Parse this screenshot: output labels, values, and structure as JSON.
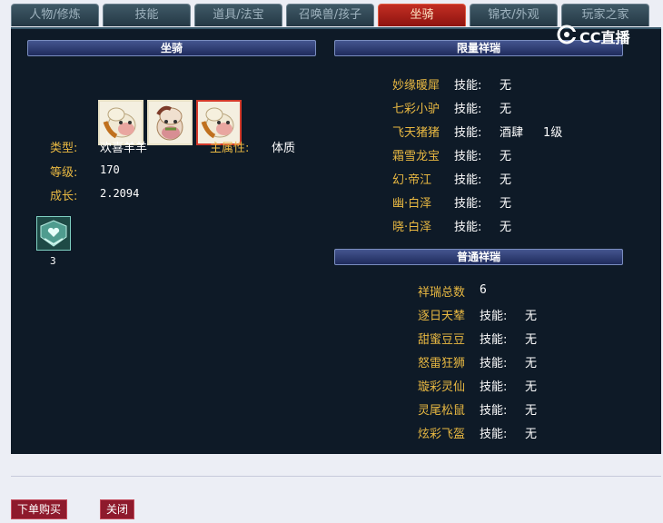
{
  "tabs": [
    {
      "label": "人物/修炼"
    },
    {
      "label": "技能"
    },
    {
      "label": "道具/法宝"
    },
    {
      "label": "召唤兽/孩子"
    },
    {
      "label": "坐骑"
    },
    {
      "label": "锦衣/外观"
    },
    {
      "label": "玩家之家"
    }
  ],
  "active_tab": "坐骑",
  "watermark": "CC直播",
  "left": {
    "banner": "坐骑",
    "mount_icons": [
      "sheep-mount-icon",
      "horse-mount-icon",
      "sheep-mount-icon"
    ],
    "type_label": "类型:",
    "type_value": "欢喜羊羊",
    "attr_label": "主属性:",
    "attr_value": "体质",
    "level_label": "等级:",
    "level_value": "170",
    "growth_label": "成长:",
    "growth_value": "2.2094",
    "skill_count": "3"
  },
  "limited": {
    "banner": "限量祥瑞",
    "rows": [
      {
        "name": "妙缘暖犀",
        "skill_label": "技能:",
        "skill": "无",
        "extra": ""
      },
      {
        "name": "七彩小驴",
        "skill_label": "技能:",
        "skill": "无",
        "extra": ""
      },
      {
        "name": "飞天猪猪",
        "skill_label": "技能:",
        "skill": "酒肆",
        "extra": "1级"
      },
      {
        "name": "霜雪龙宝",
        "skill_label": "技能:",
        "skill": "无",
        "extra": ""
      },
      {
        "name": "幻·帝江",
        "skill_label": "技能:",
        "skill": "无",
        "extra": ""
      },
      {
        "name": "幽·白泽",
        "skill_label": "技能:",
        "skill": "无",
        "extra": ""
      },
      {
        "name": "晓·白泽",
        "skill_label": "技能:",
        "skill": "无",
        "extra": ""
      }
    ]
  },
  "normal": {
    "banner": "普通祥瑞",
    "total_label": "祥瑞总数",
    "total_value": "6",
    "rows": [
      {
        "name": "逐日天辇",
        "skill_label": "技能:",
        "skill": "无"
      },
      {
        "name": "甜蜜豆豆",
        "skill_label": "技能:",
        "skill": "无"
      },
      {
        "name": "怒雷狂狮",
        "skill_label": "技能:",
        "skill": "无"
      },
      {
        "name": "璇彩灵仙",
        "skill_label": "技能:",
        "skill": "无"
      },
      {
        "name": "灵尾松鼠",
        "skill_label": "技能:",
        "skill": "无"
      },
      {
        "name": "炫彩飞盔",
        "skill_label": "技能:",
        "skill": "无"
      }
    ]
  },
  "buttons": {
    "buy": "下单购买",
    "close": "关闭"
  }
}
